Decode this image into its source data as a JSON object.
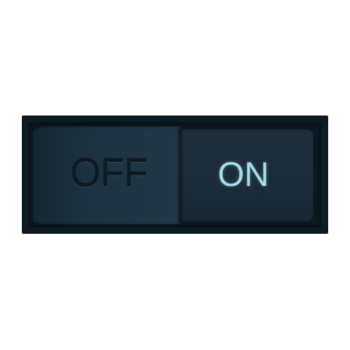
{
  "toggle": {
    "state": "on",
    "off_label": "OFF",
    "on_label": "ON"
  },
  "colors": {
    "frame": "#0d1c24",
    "rocker_off": "#1c3140",
    "rocker_on": "#1b2b38",
    "off_text": "#0f1b23",
    "on_text": "#a8dce8"
  }
}
